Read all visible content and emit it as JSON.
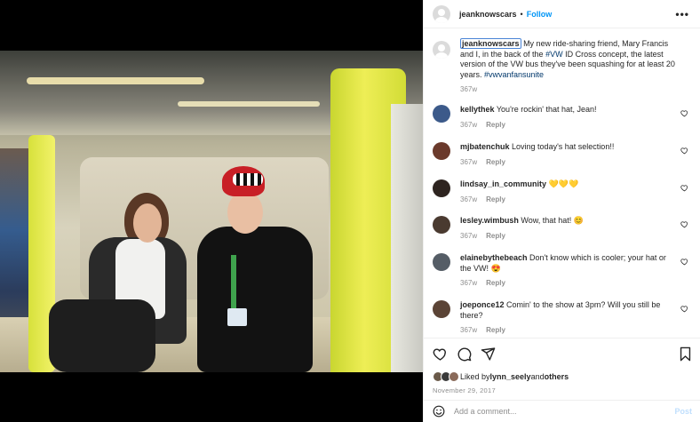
{
  "post": {
    "username": "jeanknowscars",
    "follow_label": "Follow",
    "dot": "•",
    "more_label": "•••"
  },
  "caption": {
    "username": "jeanknowscars",
    "text_1": "My new ride-sharing friend, Mary Francis and I, in the back of the ",
    "hashtag_1": "#VW",
    "text_2": " ID Cross concept, the latest version of the VW bus they've been squashing for at least 20 years. ",
    "hashtag_2": "#vwvanfansunite",
    "age": "367w"
  },
  "comments": [
    {
      "user": "kellythek",
      "text": "You're rockin' that hat, Jean!",
      "age": "367w",
      "reply": "Reply",
      "avatar_color": "#3c5a8a"
    },
    {
      "user": "mjbatenchuk",
      "text": "Loving today's hat selection!!",
      "age": "367w",
      "reply": "Reply",
      "avatar_color": "#6b3a2c"
    },
    {
      "user": "lindsay_in_community",
      "text": "💛💛💛",
      "age": "367w",
      "reply": "Reply",
      "avatar_color": "#2e2420"
    },
    {
      "user": "lesley.wimbush",
      "text": "Wow, that hat! 😊",
      "age": "367w",
      "reply": "Reply",
      "avatar_color": "#4a3a30"
    },
    {
      "user": "elainebythebeach",
      "text": "Don't know which is cooler; your hat or the VW! 😍",
      "age": "367w",
      "reply": "Reply",
      "avatar_color": "#555d66"
    },
    {
      "user": "joeponce12",
      "text": "Comin' to the show at 3pm? Will you still be there?",
      "age": "367w",
      "reply": "Reply",
      "avatar_color": "#5b4436"
    }
  ],
  "likes": {
    "prefix": "Liked by ",
    "user": "lynn_seely",
    "middle": " and ",
    "others": "others",
    "avatar_colors": [
      "#6a5a4a",
      "#3a3a3a",
      "#8a6a5a"
    ]
  },
  "date": "November 29, 2017",
  "add_comment": {
    "placeholder": "Add a comment...",
    "post_label": "Post"
  }
}
